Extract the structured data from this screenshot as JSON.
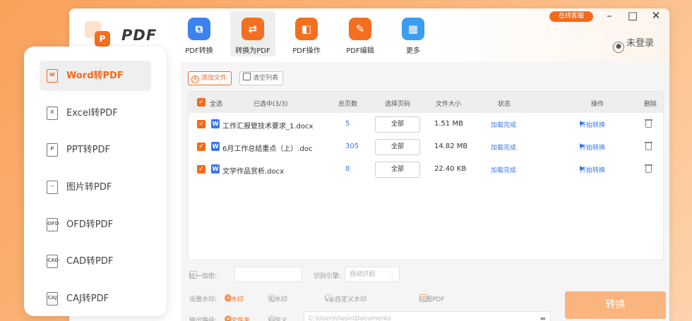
{
  "app": {
    "logo_text": "PDF",
    "online_service": "在线客服",
    "login_label": "未登录"
  },
  "toolbar": [
    {
      "label": "PDF转换",
      "color": "#3b82f0",
      "icon": "convert-icon"
    },
    {
      "label": "转换为PDF",
      "color": "#f46f1f",
      "icon": "to-pdf-icon",
      "active": true
    },
    {
      "label": "PDF操作",
      "color": "#f46f1f",
      "icon": "operate-icon"
    },
    {
      "label": "PDF编辑",
      "color": "#f46f1f",
      "icon": "edit-icon"
    },
    {
      "label": "更多",
      "color": "#3b9df0",
      "icon": "grid-icon"
    }
  ],
  "sidebar": [
    {
      "label": "Word转PDF",
      "icon": "W",
      "active": true
    },
    {
      "label": "Excel转PDF",
      "icon": "X"
    },
    {
      "label": "PPT转PDF",
      "icon": "P"
    },
    {
      "label": "图片转PDF",
      "icon": "IMG"
    },
    {
      "label": "OFD转PDF",
      "icon": "OFD"
    },
    {
      "label": "CAD转PDF",
      "icon": "CAD"
    },
    {
      "label": "CAJ转PDF",
      "icon": "CAJ"
    }
  ],
  "actions": {
    "add_file": "添加文件",
    "clear_list": "清空列表"
  },
  "table": {
    "headers": {
      "select_all": "全选",
      "selected": "已选中(3/3)",
      "pages": "总页数",
      "page_select": "选择页码",
      "size": "文件大小",
      "status": "状态",
      "operation": "操作",
      "delete": "删除"
    },
    "rows": [
      {
        "name": "工作汇报管技术要求_1.docx",
        "pages": "5",
        "page_select": "全部",
        "size": "1.51 MB",
        "status": "加载完成",
        "operation": "开始转换"
      },
      {
        "name": "6月工作总结重点（上）.doc",
        "pages": "305",
        "page_select": "全部",
        "size": "14.82 MB",
        "status": "加载完成",
        "operation": "开始转换"
      },
      {
        "name": "文学作品赏析.docx",
        "pages": "8",
        "page_select": "全部",
        "size": "22.40 KB",
        "status": "加载完成",
        "operation": "开始转换"
      }
    ]
  },
  "settings": {
    "encrypt_label": "统一加密:",
    "engine_label": "识别引擎:",
    "engine_value": "自动识别",
    "watermark_label": "设置水印:",
    "watermark_options": [
      "有水印",
      "无水印",
      "Vip自定义水印"
    ],
    "pure_pdf": "纯图PDF",
    "output_label": "输出路径:",
    "output_options": [
      "原文件夹",
      "自定义"
    ],
    "output_path": "C:\\Users\\hejin\\Documents"
  },
  "convert_button": "转换"
}
